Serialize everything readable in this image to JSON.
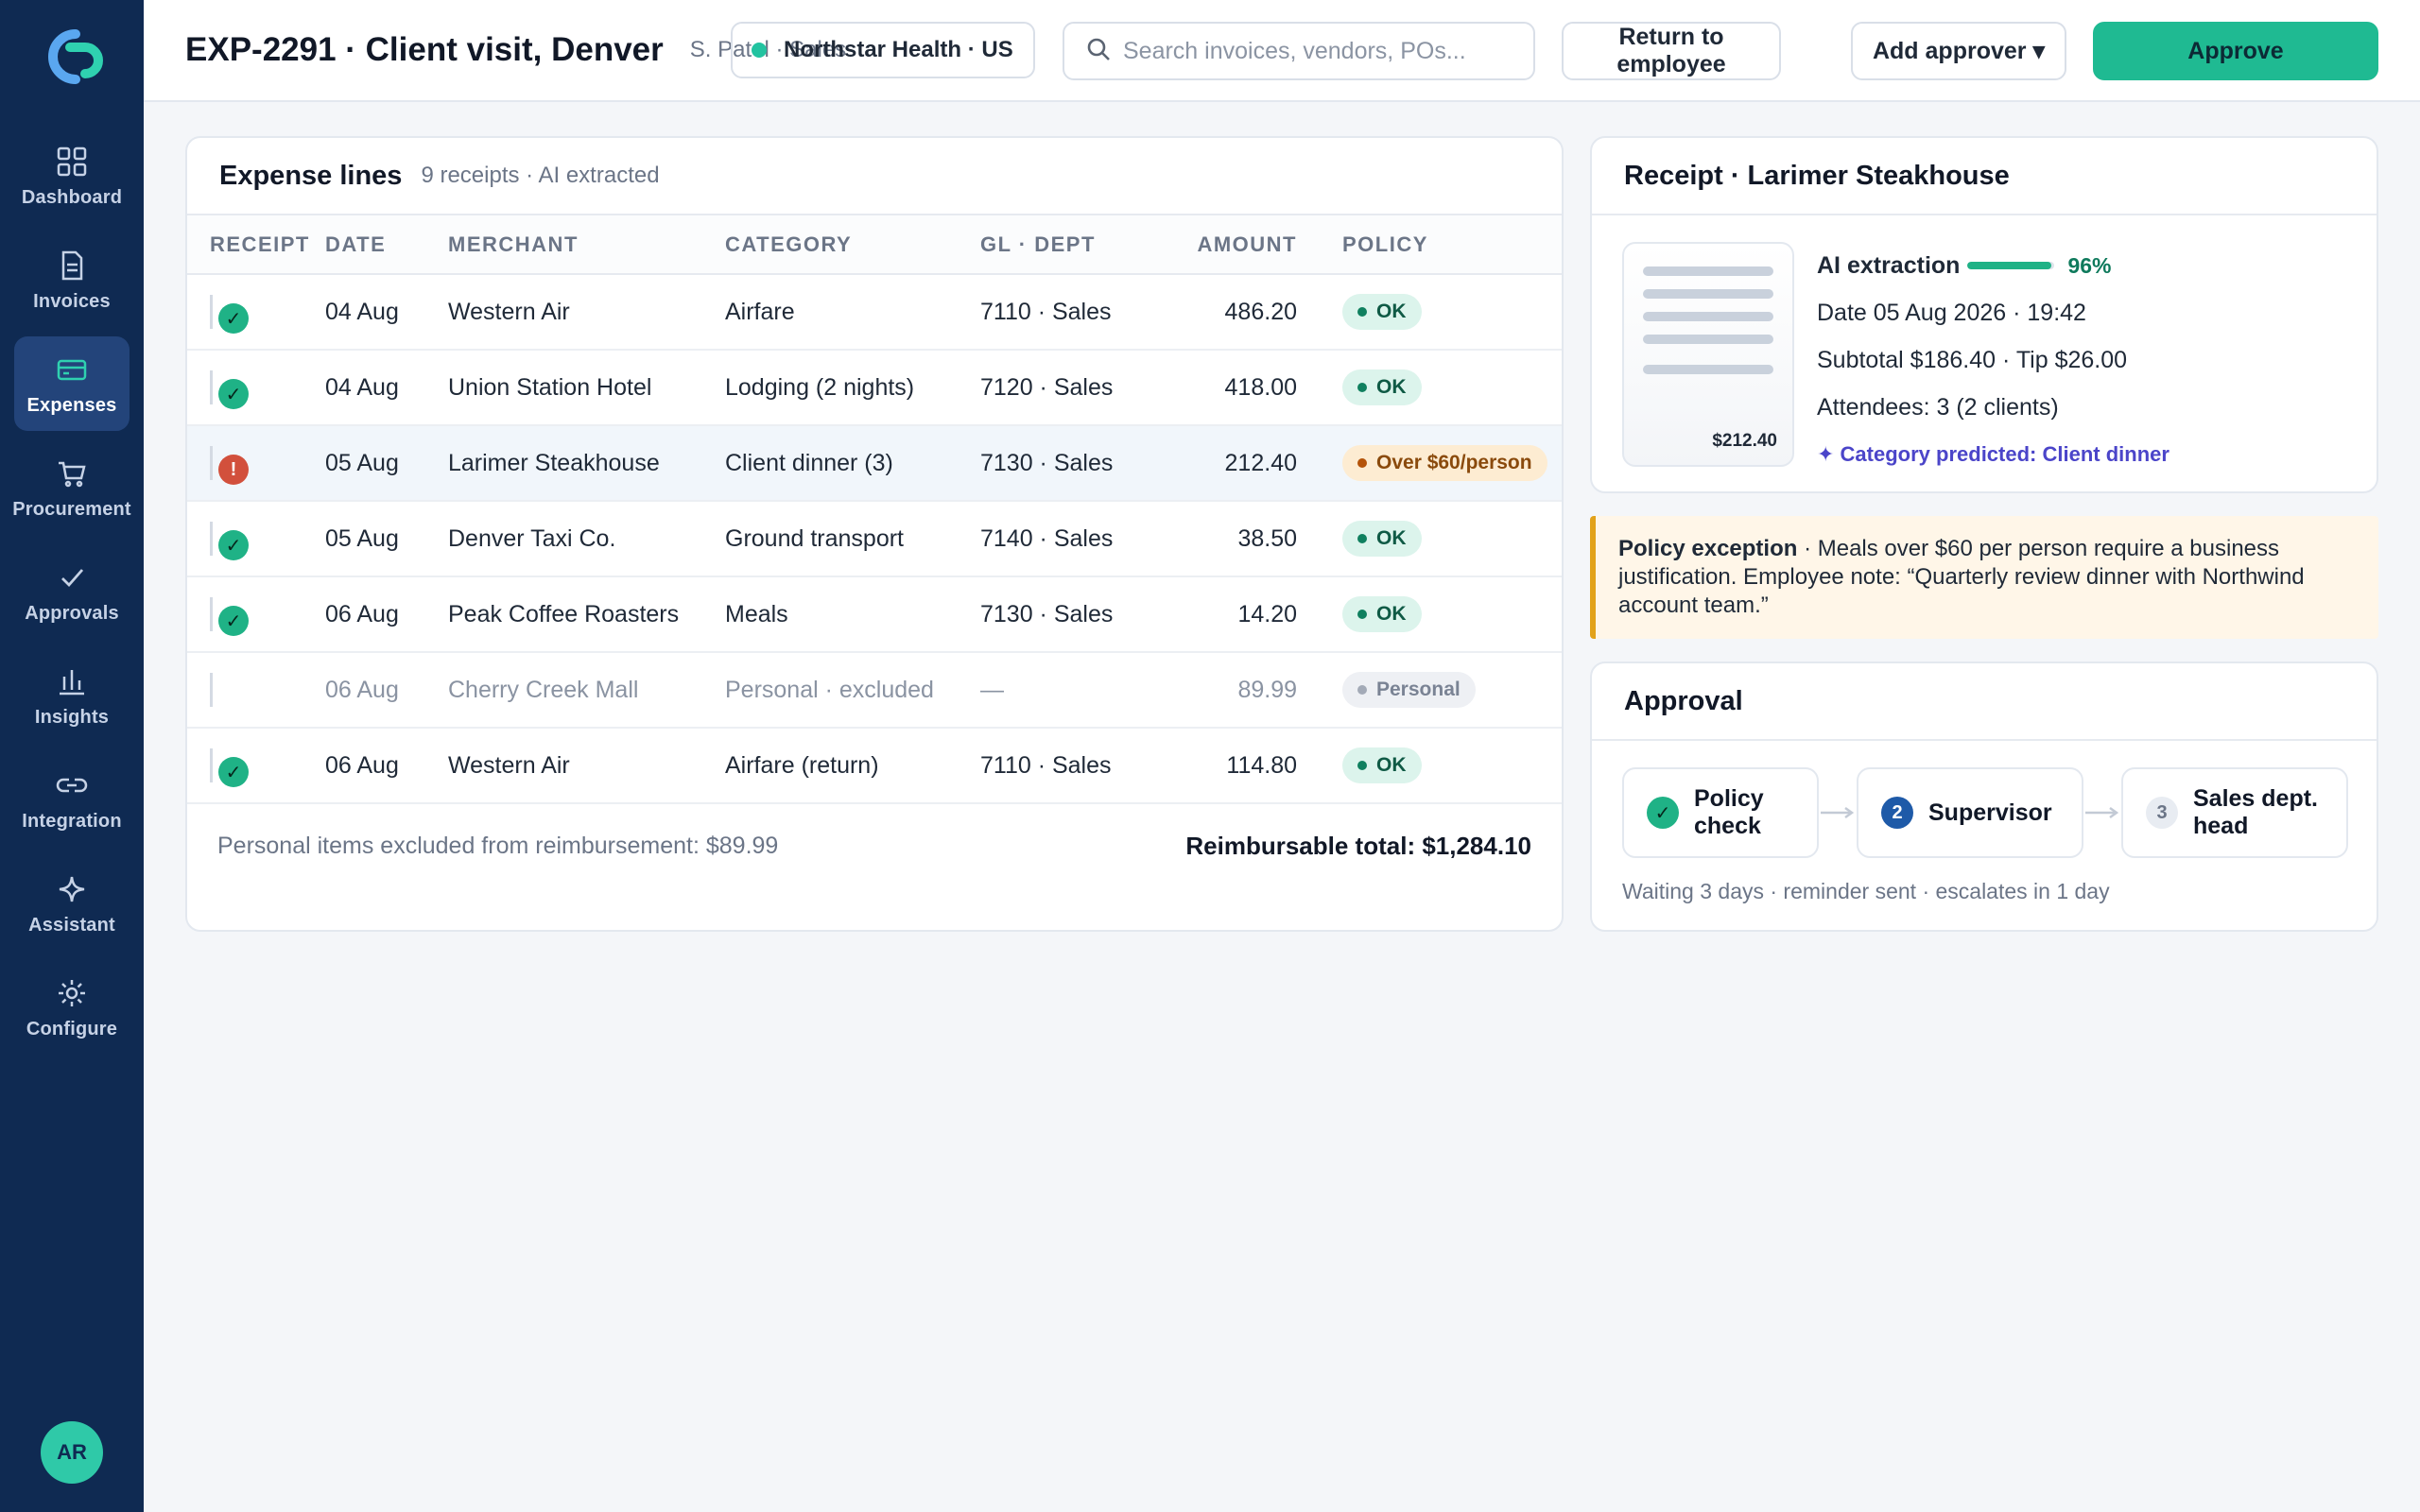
{
  "sidebar": {
    "items": [
      {
        "label": "Dashboard",
        "icon": "grid-icon"
      },
      {
        "label": "Invoices",
        "icon": "document-icon"
      },
      {
        "label": "Expenses",
        "icon": "card-icon",
        "active": true
      },
      {
        "label": "Procurement",
        "icon": "cart-icon"
      },
      {
        "label": "Approvals",
        "icon": "check-icon"
      },
      {
        "label": "Insights",
        "icon": "bar-chart-icon"
      },
      {
        "label": "Integration",
        "icon": "link-icon"
      },
      {
        "label": "Assistant",
        "icon": "sparkle-icon"
      },
      {
        "label": "Configure",
        "icon": "gear-icon"
      }
    ],
    "avatar": "AR"
  },
  "header": {
    "title": "EXP-2291 · Client visit, Denver",
    "subtitle": "S. Patel · Sales",
    "org": "Northstar Health · US",
    "search_placeholder": "Search invoices, vendors, POs...",
    "return_label": "Return to employee",
    "add_approver_label": "Add approver ▾",
    "approve_label": "Approve"
  },
  "expenses": {
    "title": "Expense lines",
    "subtitle": "9 receipts · AI extracted",
    "columns": [
      "RECEIPT",
      "DATE",
      "MERCHANT",
      "CATEGORY",
      "GL · DEPT",
      "AMOUNT",
      "POLICY"
    ],
    "rows": [
      {
        "receipt": "✓",
        "date": "04 Aug",
        "merchant": "Western Air",
        "category": "Airfare",
        "gl": "7110 · Sales",
        "amount": "486.20",
        "policy": "OK"
      },
      {
        "receipt": "✓",
        "date": "04 Aug",
        "merchant": "Union Station Hotel",
        "category": "Lodging (2 nights)",
        "gl": "7120 · Sales",
        "amount": "418.00",
        "policy": "OK"
      },
      {
        "receipt": "!",
        "date": "05 Aug",
        "merchant": "Larimer Steakhouse",
        "category": "Client dinner (3)",
        "gl": "7130 · Sales",
        "amount": "212.40",
        "policy": "Over $60/person"
      },
      {
        "receipt": "✓",
        "date": "05 Aug",
        "merchant": "Denver Taxi Co.",
        "category": "Ground transport",
        "gl": "7140 · Sales",
        "amount": "38.50",
        "policy": "OK"
      },
      {
        "receipt": "✓",
        "date": "06 Aug",
        "merchant": "Peak Coffee Roasters",
        "category": "Meals",
        "gl": "7130 · Sales",
        "amount": "14.20",
        "policy": "OK"
      },
      {
        "receipt": "",
        "date": "06 Aug",
        "merchant": "Cherry Creek Mall",
        "category": "Personal · excluded",
        "gl": "—",
        "amount": "89.99",
        "policy": "Personal"
      },
      {
        "receipt": "✓",
        "date": "06 Aug",
        "merchant": "Western Air",
        "category": "Airfare (return)",
        "gl": "7110 · Sales",
        "amount": "114.80",
        "policy": "OK"
      }
    ],
    "footer_left": "Personal items excluded from reimbursement: $89.99",
    "footer_right": "Reimbursable total: $1,284.10"
  },
  "receipt": {
    "title": "Receipt · Larimer Steakhouse",
    "thumb_amount": "$212.40",
    "ai_label": "AI extraction",
    "ai_confidence": 0.96,
    "ai_pct": "96%",
    "date_line": "Date 05 Aug 2026 · 19:42",
    "subtotal_line": "Subtotal $186.40 · Tip $26.00",
    "attendees_line": "Attendees: 3 (2 clients)",
    "predicted": "✦ Category predicted: Client dinner"
  },
  "policy_alert": {
    "heading": "Policy exception",
    "text": " · Meals over $60 per person require a business justification. Employee note: “Quarterly review dinner with Northwind account team.”"
  },
  "approval": {
    "title": "Approval",
    "steps": [
      {
        "n": "✓",
        "label": "Policy check"
      },
      {
        "n": "2",
        "label": "Supervisor"
      },
      {
        "n": "3",
        "label": "Sales dept. head"
      }
    ],
    "status": "Waiting 3 days · reminder sent · escalates in 1 day"
  },
  "colors": {
    "sidebar": "#0f2a52",
    "accent": "#1fba92",
    "warning": "#e2a21a",
    "danger": "#d2503c"
  }
}
